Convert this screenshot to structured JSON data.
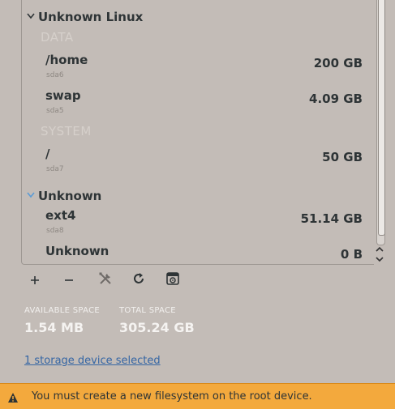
{
  "groups": [
    {
      "name": "Unknown Linux",
      "sections": [
        {
          "label": "DATA",
          "rows": [
            {
              "name": "/home",
              "device": "sda6",
              "size": "200 GB"
            },
            {
              "name": "swap",
              "device": "sda5",
              "size": "4.09 GB"
            }
          ]
        },
        {
          "label": "SYSTEM",
          "rows": [
            {
              "name": "/",
              "device": "sda7",
              "size": "50 GB"
            }
          ]
        }
      ]
    },
    {
      "name": "Unknown",
      "rows": [
        {
          "name": "ext4",
          "device": "sda8",
          "size": "51.14 GB"
        },
        {
          "name": "Unknown",
          "device": "",
          "size": "0 B"
        }
      ]
    }
  ],
  "toolbar": {
    "icons": [
      "add-icon",
      "remove-icon",
      "configure-icon",
      "refresh-icon",
      "format-disk-icon"
    ]
  },
  "stats": {
    "available_label": "AVAILABLE SPACE",
    "available_value": "1.54 MB",
    "total_label": "TOTAL SPACE",
    "total_value": "305.24 GB"
  },
  "device_link": "1 storage device selected",
  "warning": {
    "text": "You must create a new filesystem on the root device."
  },
  "colors": {
    "background": "#c3bcb7",
    "warning": "#f3a93d",
    "link": "#3465a4",
    "expander_active": "#5b9bd5"
  }
}
